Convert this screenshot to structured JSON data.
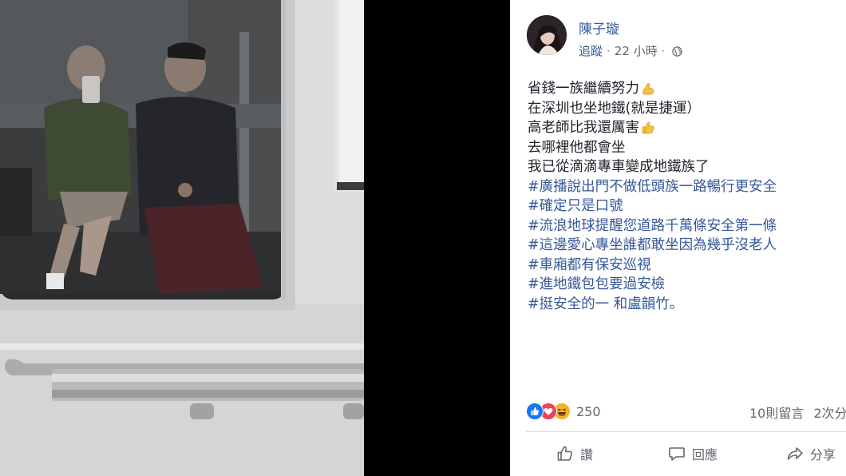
{
  "post": {
    "author": "陳子璇",
    "follow_label": "追蹤",
    "separator": "·",
    "timestamp": "22 小時",
    "body_lines": [
      {
        "text": "省錢一族繼續努力",
        "emoji": "flexed-biceps"
      },
      {
        "text": "在深圳也坐地鐵(就是捷運）"
      },
      {
        "text": "高老師比我還厲害",
        "emoji": "thumbs-up"
      },
      {
        "text": "去哪裡他都會坐"
      },
      {
        "text": "我已從滴滴專車變成地鐵族了"
      }
    ],
    "hashtags": [
      "#廣播說出門不做低頭族一路暢行更安全",
      "#確定只是口號",
      "#流浪地球提醒您道路千萬條安全第一條",
      "#這邊愛心專坐誰都敢坐因為幾乎沒老人",
      "#車廂都有保安巡視",
      "#進地鐵包包要過安檢"
    ],
    "last_line": {
      "tag": "#挺安全的一",
      "rest": " 和盧韻竹。"
    },
    "reaction_count": "250",
    "comments": "10則留言",
    "shares": "2次分",
    "actions": {
      "like": "讚",
      "comment": "回應",
      "share": "分享"
    }
  },
  "colors": {
    "link_blue": "#385898",
    "text": "#1d2129",
    "meta_gray": "#616770",
    "like_blue": "#1877f2",
    "love_red": "#f33e58",
    "haha_yellow": "#f7b125"
  },
  "icons": {
    "privacy": "globe-icon",
    "reactions": [
      "like-icon",
      "love-icon",
      "haha-icon"
    ],
    "actions": [
      "thumbs-up-icon",
      "comment-bubble-icon",
      "share-arrow-icon"
    ]
  }
}
